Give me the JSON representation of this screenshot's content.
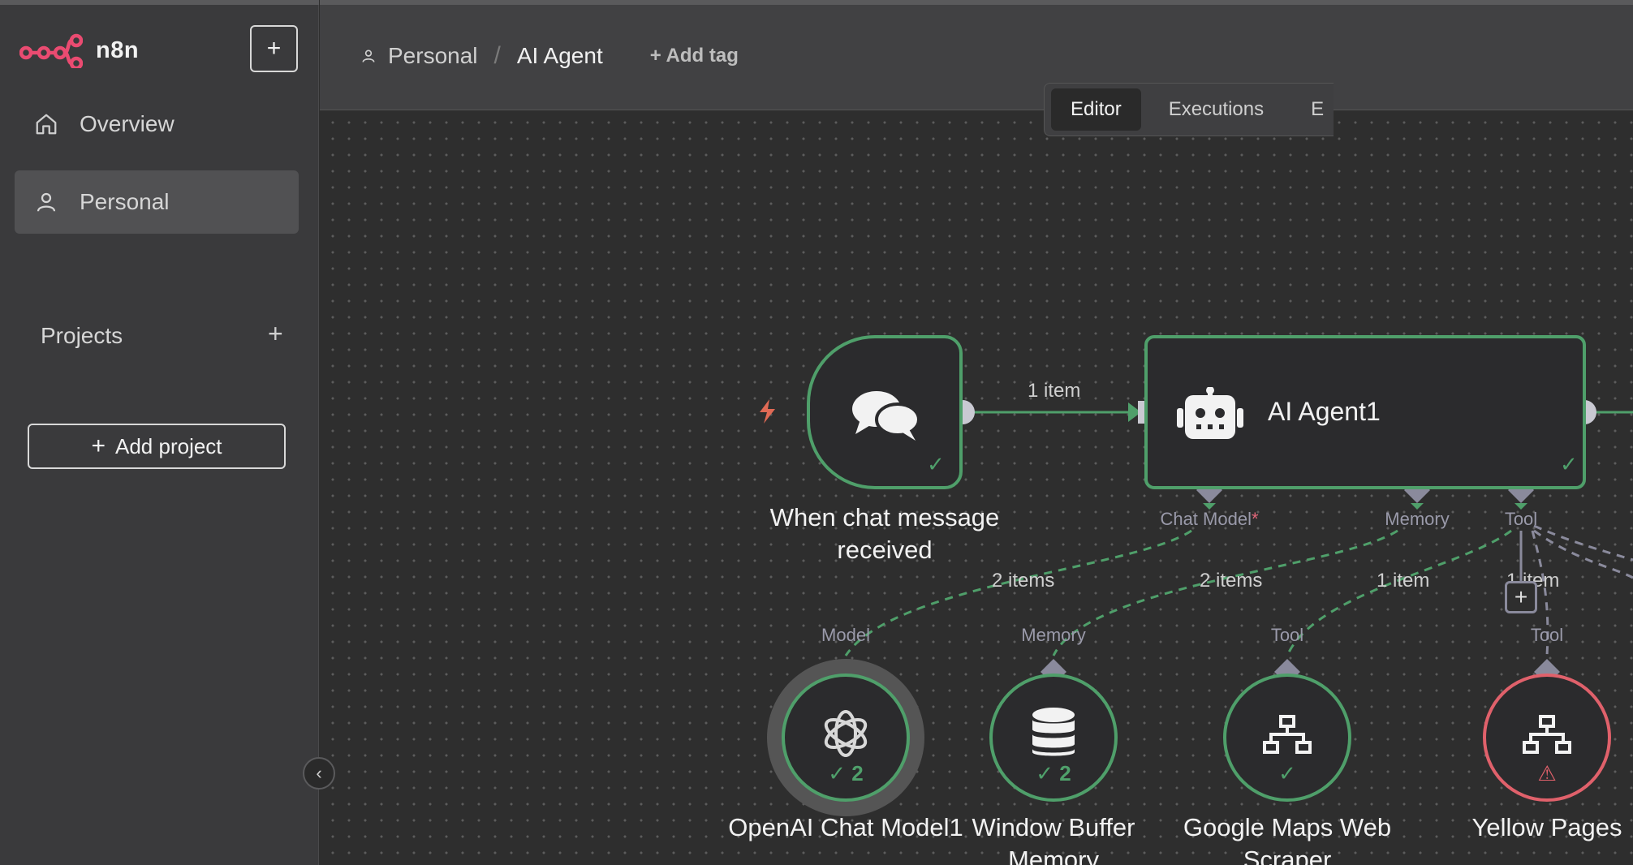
{
  "sidebar": {
    "logo_text": "n8n",
    "new_button": "+",
    "nav": [
      {
        "label": "Overview",
        "icon": "home-icon"
      },
      {
        "label": "Personal",
        "icon": "user-icon"
      }
    ],
    "projects_label": "Projects",
    "projects_add": "+",
    "add_project_label": "Add project",
    "add_project_icon": "+",
    "collapse_icon": "‹"
  },
  "header": {
    "breadcrumb_project": "Personal",
    "breadcrumb_separator": "/",
    "workflow_name": "AI Agent",
    "add_tag": "+ Add tag"
  },
  "tabs": {
    "editor": "Editor",
    "executions": "Executions",
    "evaluations": "E"
  },
  "canvas": {
    "trigger_node": {
      "title_line1": "When chat message",
      "title_line2": "received",
      "status": "✓"
    },
    "main_edge_label": "1 item",
    "agent_node": {
      "title": "AI Agent1",
      "status": "✓"
    },
    "agent_ports": {
      "chat_model": "Chat Model",
      "required_mark": "*",
      "memory": "Memory",
      "tool": "Tool"
    },
    "sub_edges": {
      "model": "2 items",
      "memory": "2 items",
      "tool1": "1 item",
      "tool2": "1 item"
    },
    "add_tool": "+",
    "sub_nodes": [
      {
        "port": "Model",
        "title_line1": "OpenAI Chat Model1",
        "title_line2": "",
        "badge": "✓ 2",
        "icon": "openai-icon",
        "status": "success"
      },
      {
        "port": "Memory",
        "title_line1": "Window Buffer",
        "title_line2": "Memory",
        "badge": "✓ 2",
        "icon": "database-icon",
        "status": "success"
      },
      {
        "port": "Tool",
        "title_line1": "Google Maps Web",
        "title_line2": "Scraper",
        "badge": "✓",
        "icon": "network-icon",
        "status": "success"
      },
      {
        "port": "Tool",
        "title_line1": "Yellow Pages",
        "title_line2": "",
        "badge": "⚠",
        "icon": "network-icon",
        "status": "error"
      }
    ]
  },
  "colors": {
    "success": "#4f9f6a",
    "error": "#e0616b",
    "brand": "#ea4b71"
  }
}
